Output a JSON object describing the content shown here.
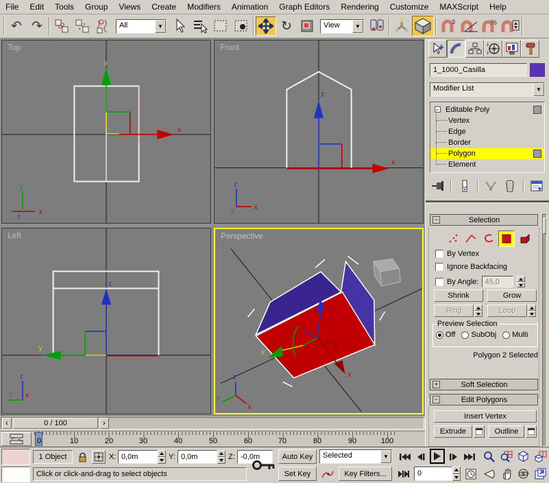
{
  "menu": {
    "items": [
      "File",
      "Edit",
      "Tools",
      "Group",
      "Views",
      "Create",
      "Modifiers",
      "Animation",
      "Graph Editors",
      "Rendering",
      "Customize",
      "MAXScript",
      "Help"
    ]
  },
  "toolbar": {
    "selection_filter": "All",
    "coord_system": "View"
  },
  "viewports": {
    "top_label": "Top",
    "front_label": "Front",
    "left_label": "Left",
    "perspective_label": "Perspective",
    "axis_x": "x",
    "axis_y": "y",
    "axis_z": "z",
    "colors": {
      "selected_face": "#c00000",
      "roof_left": "#3a2590",
      "roof_right": "#4733a6",
      "background": "#7d7d7d",
      "active_border": "#ffff00"
    }
  },
  "command_panel": {
    "object_name": "1_1000_Casilla",
    "object_color": "#5a33b4",
    "modifier_list": "Modifier List",
    "stack": {
      "root": "Editable Poly",
      "items": [
        "Vertex",
        "Edge",
        "Border",
        "Polygon",
        "Element"
      ],
      "selected": "Polygon"
    },
    "selection": {
      "title": "Selection",
      "by_vertex": "By Vertex",
      "ignore_backfacing": "Ignore Backfacing",
      "by_angle": "By Angle:",
      "by_angle_value": "45,0",
      "shrink": "Shrink",
      "grow": "Grow",
      "ring": "Ring",
      "loop": "Loop",
      "preview_legend": "Preview Selection",
      "preview_options": [
        "Off",
        "SubObj",
        "Multi"
      ],
      "preview_selected": "Off",
      "status": "Polygon 2 Selected"
    },
    "soft_selection": "Soft Selection",
    "edit_polygons": {
      "title": "Edit Polygons",
      "insert_vertex": "Insert Vertex",
      "extrude": "Extrude",
      "outline": "Outline"
    }
  },
  "timeline": {
    "slider_label": "0 / 100",
    "ticks": [
      "0",
      "10",
      "20",
      "30",
      "40",
      "50",
      "60",
      "70",
      "80",
      "90",
      "100"
    ]
  },
  "status_bar": {
    "object_count": "1 Object",
    "x_label": "X:",
    "y_label": "Y:",
    "z_label": "Z:",
    "x_value": "0,0m",
    "y_value": "0,0m",
    "z_value": "-0,0m",
    "prompt": "Click or click-and-drag to select objects",
    "auto_key": "Auto Key",
    "set_key": "Set Key",
    "selected_filter": "Selected",
    "key_filters": "Key Filters...",
    "frame_value": "0"
  }
}
